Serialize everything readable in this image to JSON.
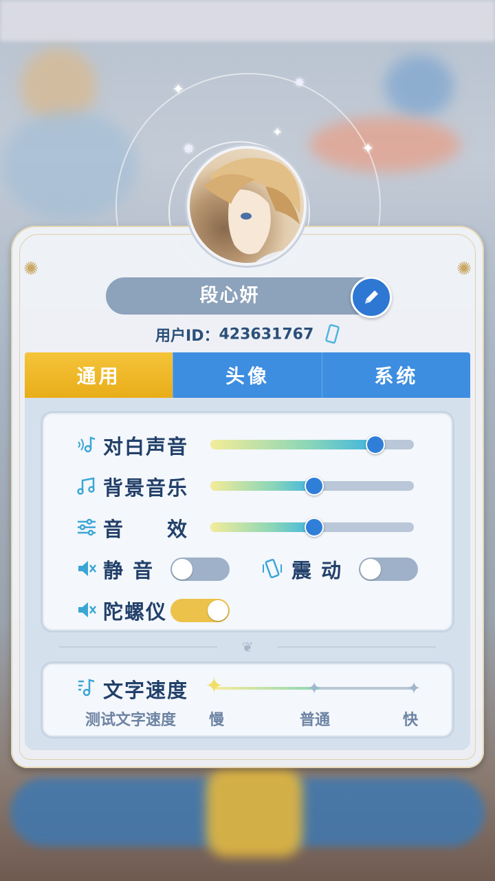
{
  "profile": {
    "name": "段心妍",
    "uid_label": "用户ID：",
    "uid": "423631767"
  },
  "tabs": [
    {
      "label": "通用",
      "active": true
    },
    {
      "label": "头像",
      "active": false
    },
    {
      "label": "系统",
      "active": false
    }
  ],
  "audio": {
    "dialogue": {
      "label": "对白声音",
      "value": 0.81
    },
    "bgm": {
      "label": "背景音乐",
      "value": 0.51
    },
    "sfx": {
      "label": "音　　效",
      "value": 0.51
    }
  },
  "toggles": {
    "mute": {
      "label": "静 音",
      "on": false
    },
    "vibrate": {
      "label": "震 动",
      "on": false
    },
    "gyro": {
      "label": "陀螺仪",
      "on": true
    }
  },
  "text_speed": {
    "label": "文字速度",
    "test_label": "测试文字速度",
    "options": [
      "慢",
      "普通",
      "快"
    ],
    "selected_index": 0
  },
  "colors": {
    "accent_blue": "#2f7fd8",
    "tab_active": "#f0b827",
    "label_text": "#22406a"
  }
}
